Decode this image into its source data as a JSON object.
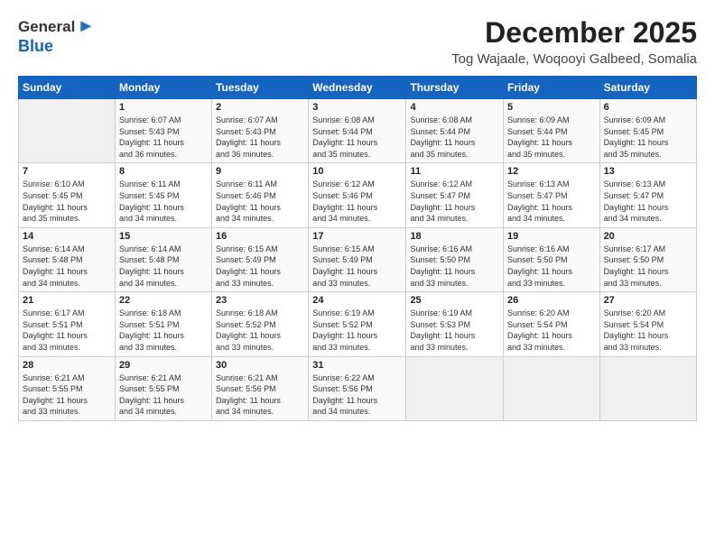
{
  "logo": {
    "general": "General",
    "blue": "Blue",
    "arrow": "▶"
  },
  "title": "December 2025",
  "subtitle": "Tog Wajaale, Woqooyi Galbeed, Somalia",
  "weekdays": [
    "Sunday",
    "Monday",
    "Tuesday",
    "Wednesday",
    "Thursday",
    "Friday",
    "Saturday"
  ],
  "weeks": [
    [
      {
        "day": "",
        "info": ""
      },
      {
        "day": "1",
        "info": "Sunrise: 6:07 AM\nSunset: 5:43 PM\nDaylight: 11 hours\nand 36 minutes."
      },
      {
        "day": "2",
        "info": "Sunrise: 6:07 AM\nSunset: 5:43 PM\nDaylight: 11 hours\nand 36 minutes."
      },
      {
        "day": "3",
        "info": "Sunrise: 6:08 AM\nSunset: 5:44 PM\nDaylight: 11 hours\nand 35 minutes."
      },
      {
        "day": "4",
        "info": "Sunrise: 6:08 AM\nSunset: 5:44 PM\nDaylight: 11 hours\nand 35 minutes."
      },
      {
        "day": "5",
        "info": "Sunrise: 6:09 AM\nSunset: 5:44 PM\nDaylight: 11 hours\nand 35 minutes."
      },
      {
        "day": "6",
        "info": "Sunrise: 6:09 AM\nSunset: 5:45 PM\nDaylight: 11 hours\nand 35 minutes."
      }
    ],
    [
      {
        "day": "7",
        "info": "Sunrise: 6:10 AM\nSunset: 5:45 PM\nDaylight: 11 hours\nand 35 minutes."
      },
      {
        "day": "8",
        "info": "Sunrise: 6:11 AM\nSunset: 5:45 PM\nDaylight: 11 hours\nand 34 minutes."
      },
      {
        "day": "9",
        "info": "Sunrise: 6:11 AM\nSunset: 5:46 PM\nDaylight: 11 hours\nand 34 minutes."
      },
      {
        "day": "10",
        "info": "Sunrise: 6:12 AM\nSunset: 5:46 PM\nDaylight: 11 hours\nand 34 minutes."
      },
      {
        "day": "11",
        "info": "Sunrise: 6:12 AM\nSunset: 5:47 PM\nDaylight: 11 hours\nand 34 minutes."
      },
      {
        "day": "12",
        "info": "Sunrise: 6:13 AM\nSunset: 5:47 PM\nDaylight: 11 hours\nand 34 minutes."
      },
      {
        "day": "13",
        "info": "Sunrise: 6:13 AM\nSunset: 5:47 PM\nDaylight: 11 hours\nand 34 minutes."
      }
    ],
    [
      {
        "day": "14",
        "info": "Sunrise: 6:14 AM\nSunset: 5:48 PM\nDaylight: 11 hours\nand 34 minutes."
      },
      {
        "day": "15",
        "info": "Sunrise: 6:14 AM\nSunset: 5:48 PM\nDaylight: 11 hours\nand 34 minutes."
      },
      {
        "day": "16",
        "info": "Sunrise: 6:15 AM\nSunset: 5:49 PM\nDaylight: 11 hours\nand 33 minutes."
      },
      {
        "day": "17",
        "info": "Sunrise: 6:15 AM\nSunset: 5:49 PM\nDaylight: 11 hours\nand 33 minutes."
      },
      {
        "day": "18",
        "info": "Sunrise: 6:16 AM\nSunset: 5:50 PM\nDaylight: 11 hours\nand 33 minutes."
      },
      {
        "day": "19",
        "info": "Sunrise: 6:16 AM\nSunset: 5:50 PM\nDaylight: 11 hours\nand 33 minutes."
      },
      {
        "day": "20",
        "info": "Sunrise: 6:17 AM\nSunset: 5:50 PM\nDaylight: 11 hours\nand 33 minutes."
      }
    ],
    [
      {
        "day": "21",
        "info": "Sunrise: 6:17 AM\nSunset: 5:51 PM\nDaylight: 11 hours\nand 33 minutes."
      },
      {
        "day": "22",
        "info": "Sunrise: 6:18 AM\nSunset: 5:51 PM\nDaylight: 11 hours\nand 33 minutes."
      },
      {
        "day": "23",
        "info": "Sunrise: 6:18 AM\nSunset: 5:52 PM\nDaylight: 11 hours\nand 33 minutes."
      },
      {
        "day": "24",
        "info": "Sunrise: 6:19 AM\nSunset: 5:52 PM\nDaylight: 11 hours\nand 33 minutes."
      },
      {
        "day": "25",
        "info": "Sunrise: 6:19 AM\nSunset: 5:53 PM\nDaylight: 11 hours\nand 33 minutes."
      },
      {
        "day": "26",
        "info": "Sunrise: 6:20 AM\nSunset: 5:54 PM\nDaylight: 11 hours\nand 33 minutes."
      },
      {
        "day": "27",
        "info": "Sunrise: 6:20 AM\nSunset: 5:54 PM\nDaylight: 11 hours\nand 33 minutes."
      }
    ],
    [
      {
        "day": "28",
        "info": "Sunrise: 6:21 AM\nSunset: 5:55 PM\nDaylight: 11 hours\nand 33 minutes."
      },
      {
        "day": "29",
        "info": "Sunrise: 6:21 AM\nSunset: 5:55 PM\nDaylight: 11 hours\nand 34 minutes."
      },
      {
        "day": "30",
        "info": "Sunrise: 6:21 AM\nSunset: 5:56 PM\nDaylight: 11 hours\nand 34 minutes."
      },
      {
        "day": "31",
        "info": "Sunrise: 6:22 AM\nSunset: 5:56 PM\nDaylight: 11 hours\nand 34 minutes."
      },
      {
        "day": "",
        "info": ""
      },
      {
        "day": "",
        "info": ""
      },
      {
        "day": "",
        "info": ""
      }
    ]
  ]
}
